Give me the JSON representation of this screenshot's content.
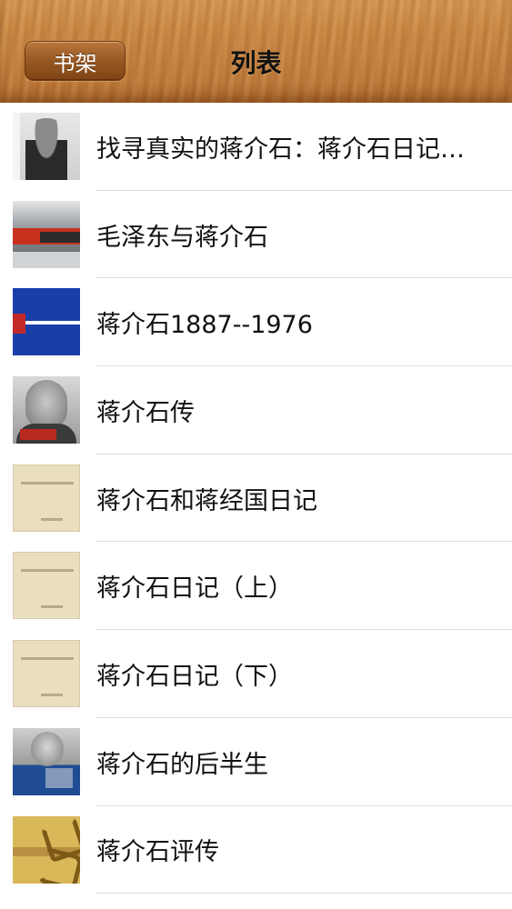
{
  "navbar": {
    "back_label": "书架",
    "title": "列表"
  },
  "books": [
    {
      "title": "找寻真实的蒋介石：蒋介石日记…",
      "cover": "book-cover-photo"
    },
    {
      "title": "毛泽东与蒋介石",
      "cover": "book-cover-photo"
    },
    {
      "title": "蒋介石1887--1976",
      "cover": "book-cover-photo"
    },
    {
      "title": "蒋介石传",
      "cover": "book-cover-photo"
    },
    {
      "title": "蒋介石和蒋经国日记",
      "cover": "book-cover-photo"
    },
    {
      "title": "蒋介石日记（上）",
      "cover": "book-cover-photo"
    },
    {
      "title": "蒋介石日记（下）",
      "cover": "book-cover-photo"
    },
    {
      "title": "蒋介石的后半生",
      "cover": "book-cover-photo"
    },
    {
      "title": "蒋介石评传",
      "cover": "book-cover-photo"
    }
  ]
}
